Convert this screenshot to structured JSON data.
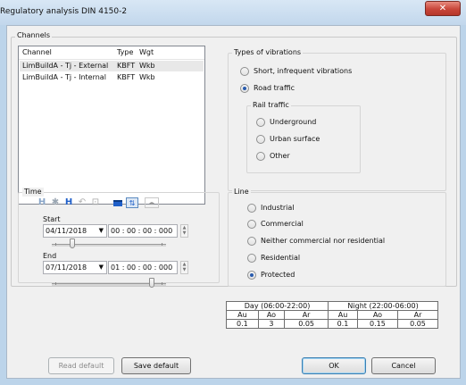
{
  "window": {
    "title": "Regulatory analysis DIN 4150-2",
    "close_glyph": "✕",
    "accent_color": "#c8463a"
  },
  "channels": {
    "group_title": "Channels",
    "columns": [
      "Channel",
      "Type",
      "Wgt"
    ],
    "rows": [
      {
        "channel": "LimBuildA - Tj - External",
        "type": "KBFT",
        "wgt": "Wkb"
      },
      {
        "channel": "LimBuildA - Tj - Internal",
        "type": "KBFT",
        "wgt": "Wkb"
      }
    ]
  },
  "types_of_vibrations": {
    "group_title": "Types of vibrations",
    "options": [
      {
        "label": "Short, infrequent vibrations",
        "selected": false
      },
      {
        "label": "Road traffic",
        "selected": true
      }
    ],
    "rail": {
      "group_title": "Rail traffic",
      "options": [
        {
          "label": "Underground",
          "selected": false
        },
        {
          "label": "Urban surface",
          "selected": false
        },
        {
          "label": "Other",
          "selected": false
        }
      ]
    }
  },
  "time": {
    "group_title": "Time",
    "toolbar_icons": [
      "cursor-bracket-icon",
      "cursor-cross-icon",
      "cursor-blue-bracket-icon",
      "undo-icon",
      "zoom-fit-icon",
      "window-icon",
      "link-cursors-icon",
      "scroll-arrows-icon"
    ],
    "start": {
      "label": "Start",
      "date": "04/11/2018",
      "time": "00 : 00 : 00 : 000",
      "slider_position": 0.18
    },
    "end": {
      "label": "End",
      "date": "07/11/2018",
      "time": "01 : 00 : 00 : 000",
      "slider_position": 0.85
    }
  },
  "line": {
    "group_title": "Line",
    "options": [
      {
        "label": "Industrial",
        "selected": false
      },
      {
        "label": "Commercial",
        "selected": false
      },
      {
        "label": "Neither commercial nor residential",
        "selected": false
      },
      {
        "label": "Residential",
        "selected": false
      },
      {
        "label": "Protected",
        "selected": true
      }
    ]
  },
  "params_table": {
    "day_header": "Day (06:00-22:00)",
    "night_header": "Night (22:00-06:00)",
    "sub_headers": [
      "Au",
      "Ao",
      "Ar",
      "Au",
      "Ao",
      "Ar"
    ],
    "values": [
      "0.1",
      "3",
      "0.05",
      "0.1",
      "0.15",
      "0.05"
    ]
  },
  "buttons": {
    "read_default": "Read default",
    "save_default": "Save default",
    "ok": "OK",
    "cancel": "Cancel"
  }
}
